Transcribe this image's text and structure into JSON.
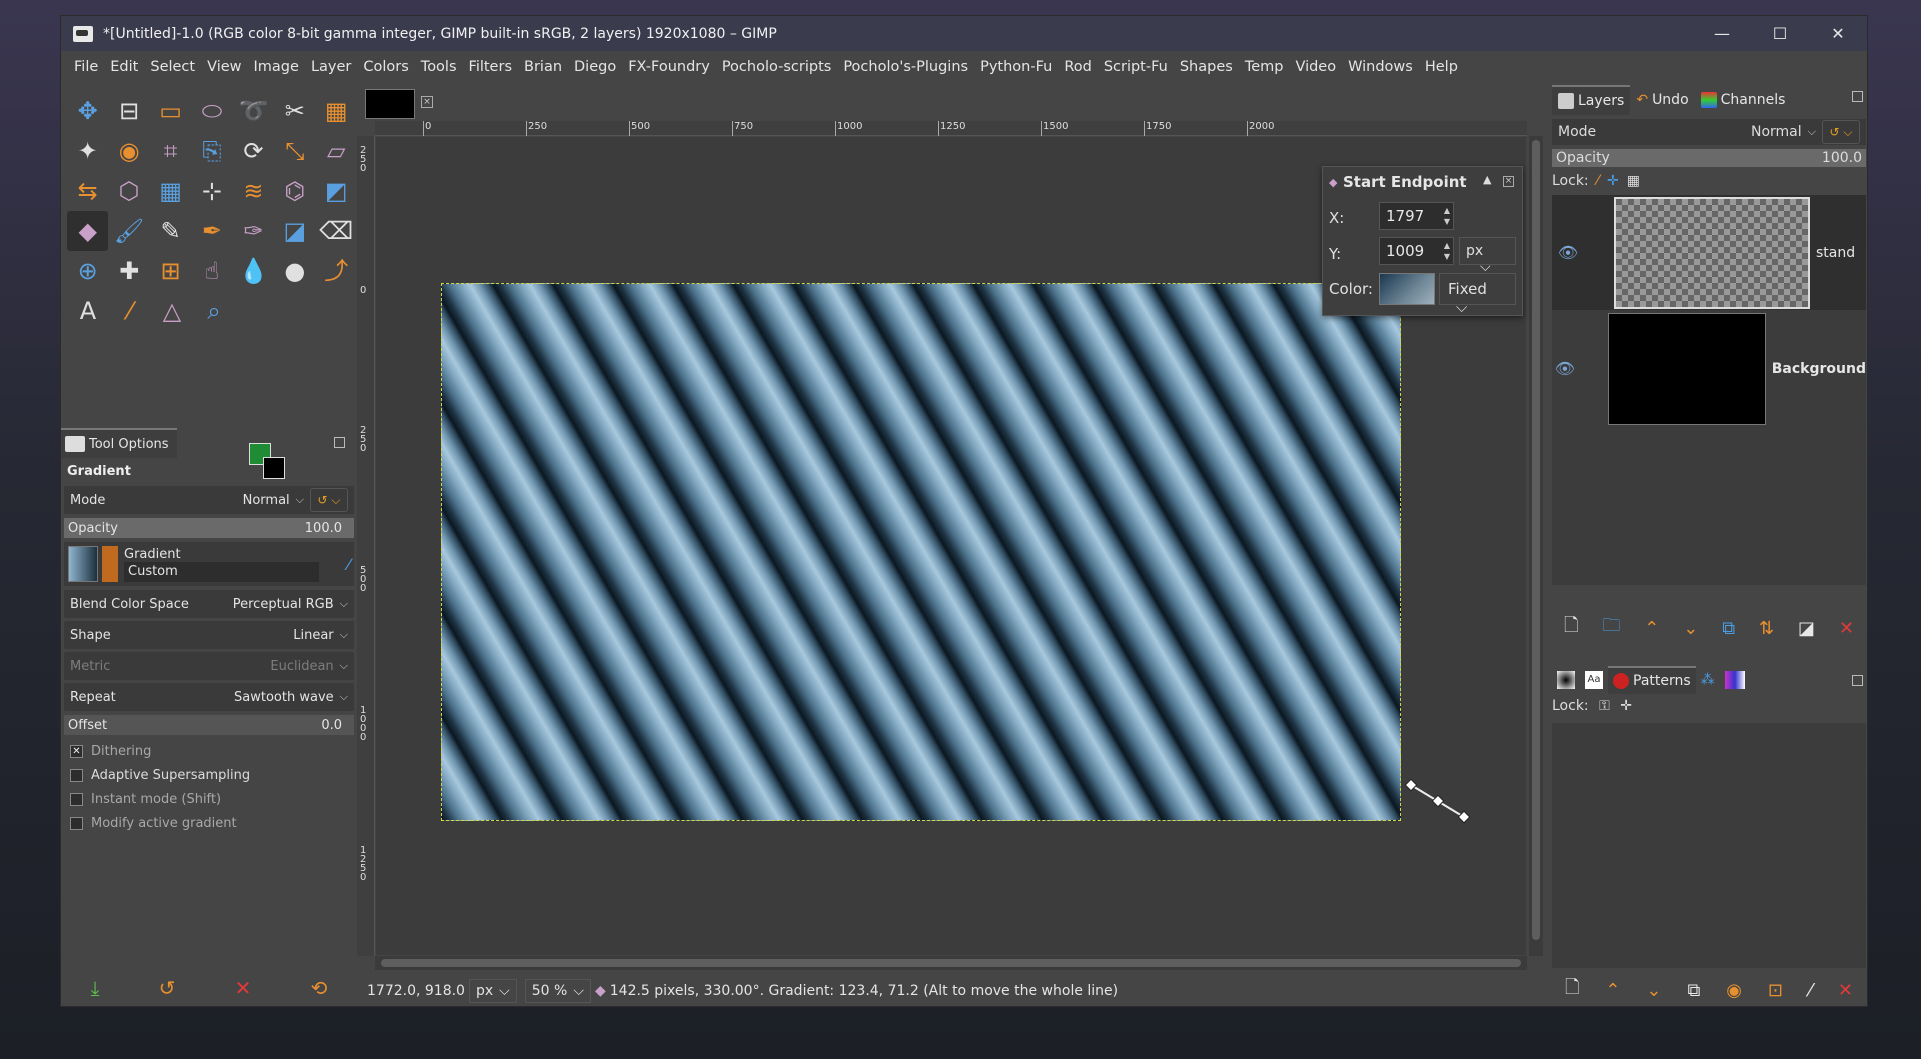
{
  "window": {
    "title": "*[Untitled]-1.0 (RGB color 8-bit gamma integer, GIMP built-in sRGB, 2 layers) 1920x1080 – GIMP",
    "minimize": "—",
    "maximize": "☐",
    "close": "✕"
  },
  "menubar": {
    "items": [
      "File",
      "Edit",
      "Select",
      "View",
      "Image",
      "Layer",
      "Colors",
      "Tools",
      "Filters",
      "Brian",
      "Diego",
      "FX-Foundry",
      "Pocholo-scripts",
      "Pocholo's-Plugins",
      "Python-Fu",
      "Rod",
      "Script-Fu",
      "Shapes",
      "Temp",
      "Video",
      "Windows",
      "Help"
    ]
  },
  "toolbox": {
    "rows": [
      [
        "move-icon",
        "align-icon",
        "rect-select-icon",
        "ellipse-select-icon",
        "free-select-icon",
        "scissors-select-icon",
        "foreground-select-icon"
      ],
      [
        "fuzzy-select-icon",
        "color-select-icon",
        "crop-icon",
        "unified-transform-icon",
        "rotate-icon",
        "scale-icon",
        "shear-icon"
      ],
      [
        "flip-icon",
        "perspective-icon",
        "3d-transform-icon",
        "handle-transform-icon",
        "warp-icon",
        "cage-icon",
        "paint-select-icon"
      ],
      [
        "gradient-icon",
        "paintbrush-icon",
        "pencil-icon",
        "airbrush-icon",
        "ink-icon",
        "mypaint-icon",
        "eraser-icon"
      ],
      [
        "clone-icon",
        "heal-icon",
        "perspective-clone-icon",
        "smudge-icon",
        "blur-icon",
        "dodge-burn-icon",
        "paths-icon"
      ],
      [
        "text-icon",
        "color-picker-icon",
        "measure-icon",
        "zoom-icon"
      ]
    ],
    "glyphs": [
      [
        "✥",
        "⊟",
        "▭",
        "⬭",
        "➰",
        "✂",
        "▦"
      ],
      [
        "✦",
        "◉",
        "⌗",
        "⎘",
        "⟳",
        "⤡",
        "▱"
      ],
      [
        "⇆",
        "⬡",
        "▦",
        "⊹",
        "≋",
        "⌬",
        "◩"
      ],
      [
        "◆",
        "🖌",
        "✎",
        "✒",
        "✑",
        "◪",
        "⌫"
      ],
      [
        "⊕",
        "✚",
        "⊞",
        "☝",
        "💧",
        "●",
        "⤴"
      ],
      [
        "A",
        "⁄",
        "△",
        "⌕"
      ]
    ]
  },
  "colors": {
    "foreground": "#1f8b34",
    "background": "#000000"
  },
  "tool_options": {
    "tab_label": "Tool Options",
    "title": "Gradient",
    "mode_label": "Mode",
    "mode_value": "Normal",
    "opacity_label": "Opacity",
    "opacity_value": "100.0",
    "gradient_label": "Gradient",
    "gradient_name": "Custom",
    "blend_label": "Blend Color Space",
    "blend_value": "Perceptual RGB",
    "shape_label": "Shape",
    "shape_value": "Linear",
    "metric_label": "Metric",
    "metric_value": "Euclidean",
    "repeat_label": "Repeat",
    "repeat_value": "Sawtooth wave",
    "offset_label": "Offset",
    "offset_value": "0.0",
    "checks": [
      {
        "label": "Dithering",
        "checked": true,
        "dim": true
      },
      {
        "label": "Adaptive Supersampling",
        "checked": false,
        "dim": false
      },
      {
        "label": "Instant mode  (Shift)",
        "checked": false,
        "dim": true
      },
      {
        "label": "Modify active gradient",
        "checked": false,
        "dim": true
      }
    ]
  },
  "ruler": {
    "h_labels": [
      "0",
      "250",
      "500",
      "750",
      "1000",
      "1250",
      "1500",
      "1750",
      "2000"
    ],
    "v_labels": [
      "2 5 0",
      "0",
      "2 5 0",
      "5 0 0",
      "1 0 0 0",
      "1 2 5 0"
    ]
  },
  "start_endpoint": {
    "title": "Start Endpoint",
    "x_label": "X:",
    "x_value": "1797",
    "y_label": "Y:",
    "y_value": "1009",
    "unit": "px",
    "color_label": "Color:",
    "color_mode": "Fixed"
  },
  "statusbar": {
    "coords": "1772.0, 918.0",
    "unit": "px",
    "zoom": "50 %",
    "message": "142.5 pixels, 330.00°. Gradient: 123.4, 71.2 (Alt to move the whole line)"
  },
  "layers_panel": {
    "tabs": [
      "Layers",
      "Undo",
      "Channels"
    ],
    "mode_label": "Mode",
    "mode_value": "Normal",
    "opacity_label": "Opacity",
    "opacity_value": "100.0",
    "lock_label": "Lock:",
    "layers": [
      {
        "name": "stand",
        "type": "transparent"
      },
      {
        "name": "Background",
        "type": "black"
      }
    ]
  },
  "patterns_panel": {
    "tab_label": "Patterns",
    "lock_label": "Lock:"
  }
}
